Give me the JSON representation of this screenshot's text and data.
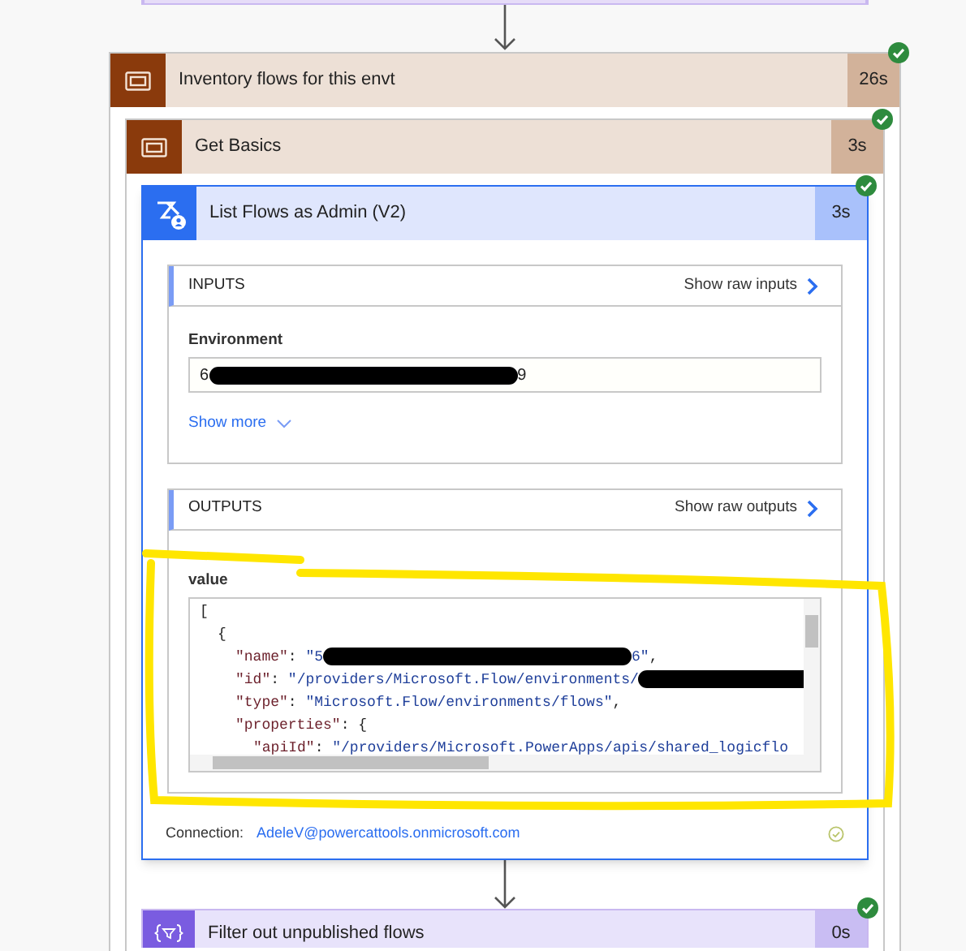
{
  "scope": {
    "title": "Inventory flows for this envt",
    "duration": "26s",
    "succeeded": true,
    "child": {
      "title": "Get Basics",
      "duration": "3s",
      "succeeded": true,
      "action": {
        "title": "List Flows as Admin (V2)",
        "duration": "3s",
        "succeeded": true,
        "inputs": {
          "header": "INPUTS",
          "raw_link": "Show raw inputs",
          "fields": [
            {
              "label": "Environment",
              "segments": [
                {
                  "kind": "text",
                  "text": "6"
                },
                {
                  "kind": "redacted"
                },
                {
                  "kind": "text",
                  "text": "9"
                }
              ]
            }
          ],
          "show_more": "Show more"
        },
        "outputs": {
          "header": "OUTPUTS",
          "raw_link": "Show raw outputs",
          "label": "value",
          "code_lines": [
            {
              "segments": [
                {
                  "kind": "text",
                  "text": "["
                }
              ],
              "children": [
                {
                  "segments": [
                    {
                      "kind": "text",
                      "text": "{"
                    }
                  ],
                  "children": [
                    {
                      "segments": [
                        {
                          "kind": "key",
                          "text": "\"name\""
                        },
                        {
                          "kind": "text",
                          "text": ": "
                        },
                        {
                          "kind": "string",
                          "text": "\"5"
                        },
                        {
                          "kind": "redacted"
                        },
                        {
                          "kind": "string",
                          "text": "6\""
                        },
                        {
                          "kind": "text",
                          "text": ","
                        }
                      ]
                    },
                    {
                      "segments": [
                        {
                          "kind": "key",
                          "text": "\"id\""
                        },
                        {
                          "kind": "text",
                          "text": ": "
                        },
                        {
                          "kind": "string",
                          "text": "\"/providers/Microsoft.Flow/environments/"
                        },
                        {
                          "kind": "redacted"
                        }
                      ]
                    },
                    {
                      "segments": [
                        {
                          "kind": "key",
                          "text": "\"type\""
                        },
                        {
                          "kind": "text",
                          "text": ": "
                        },
                        {
                          "kind": "string",
                          "text": "\"Microsoft.Flow/environments/flows\""
                        },
                        {
                          "kind": "text",
                          "text": ","
                        }
                      ]
                    },
                    {
                      "segments": [
                        {
                          "kind": "key",
                          "text": "\"properties\""
                        },
                        {
                          "kind": "text",
                          "text": ": {"
                        }
                      ],
                      "children": [
                        {
                          "segments": [
                            {
                              "kind": "key",
                              "text": "\"apiId\""
                            },
                            {
                              "kind": "text",
                              "text": ": "
                            },
                            {
                              "kind": "string",
                              "text": "\"/providers/Microsoft.PowerApps/apis/shared_logicflo"
                            }
                          ]
                        }
                      ]
                    }
                  ]
                }
              ]
            }
          ]
        },
        "connection": {
          "label": "Connection:",
          "account": "AdeleV@powercattools.onmicrosoft.com"
        }
      }
    }
  },
  "next_step": {
    "title": "Filter out unpublished flows",
    "duration": "0s",
    "succeeded": true
  }
}
